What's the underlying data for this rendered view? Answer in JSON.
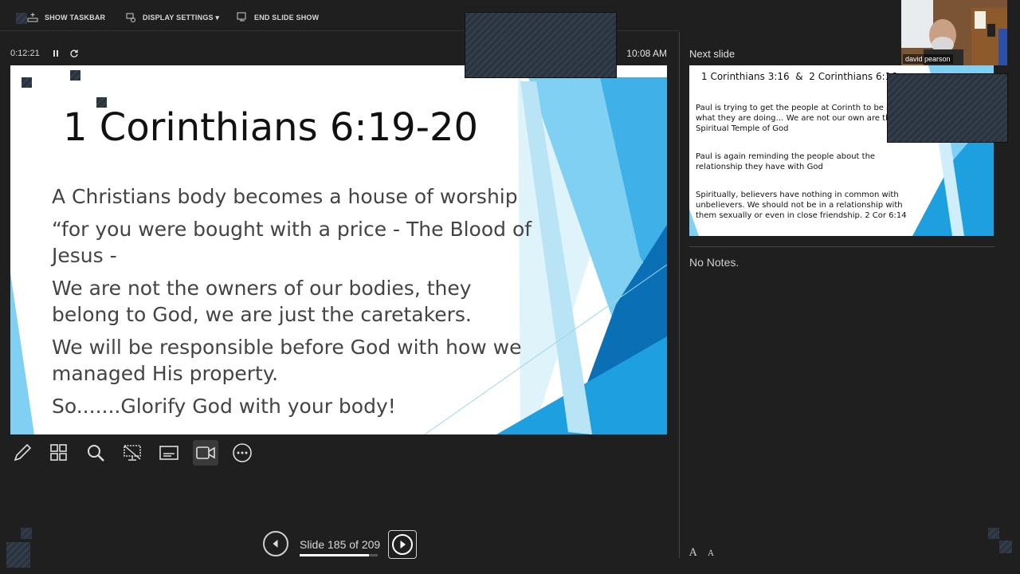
{
  "toolbar": {
    "show_taskbar": "SHOW TASKBAR",
    "display_settings": "DISPLAY SETTINGS ▾",
    "end_slide_show": "END SLIDE SHOW"
  },
  "status": {
    "elapsed": "0:12:21",
    "clock": "10:08 AM"
  },
  "current_slide": {
    "title": "1 Corinthians 6:19-20",
    "lines": [
      "A Christians body becomes a house of worship",
      "“for you were bought with a price - The Blood of Jesus -",
      "We are not the owners of our bodies, they belong to God, we are just the caretakers.",
      "We will be responsible before God with how we managed His property.",
      "So.......Glorify God with your body!"
    ]
  },
  "next_panel": {
    "label": "Next slide",
    "title": "1 Corinthians 3:16  &  2 Corinthians 6:16",
    "lines": [
      "Paul is trying to get the people at Corinth to be about what they are doing… We are not our own are the Spiritual Temple of God",
      "Paul is again reminding the people about the relationship they have with God",
      "Spiritually, believers have nothing in common with unbelievers. We should not be in a relationship with them sexually or even in close friendship. 2 Cor 6:14"
    ],
    "notes": "No Notes."
  },
  "navigation": {
    "counter": "Slide 185 of 209",
    "current": 185,
    "total": 209
  },
  "font_controls": {
    "increase": "A",
    "decrease": "A"
  },
  "video": {
    "participant": "david pearson"
  },
  "colors": {
    "accent_blue": "#1ea0e0",
    "light_blue": "#7fd0f2",
    "dark_blue": "#0b6fb5",
    "background": "#1f1f1f"
  }
}
